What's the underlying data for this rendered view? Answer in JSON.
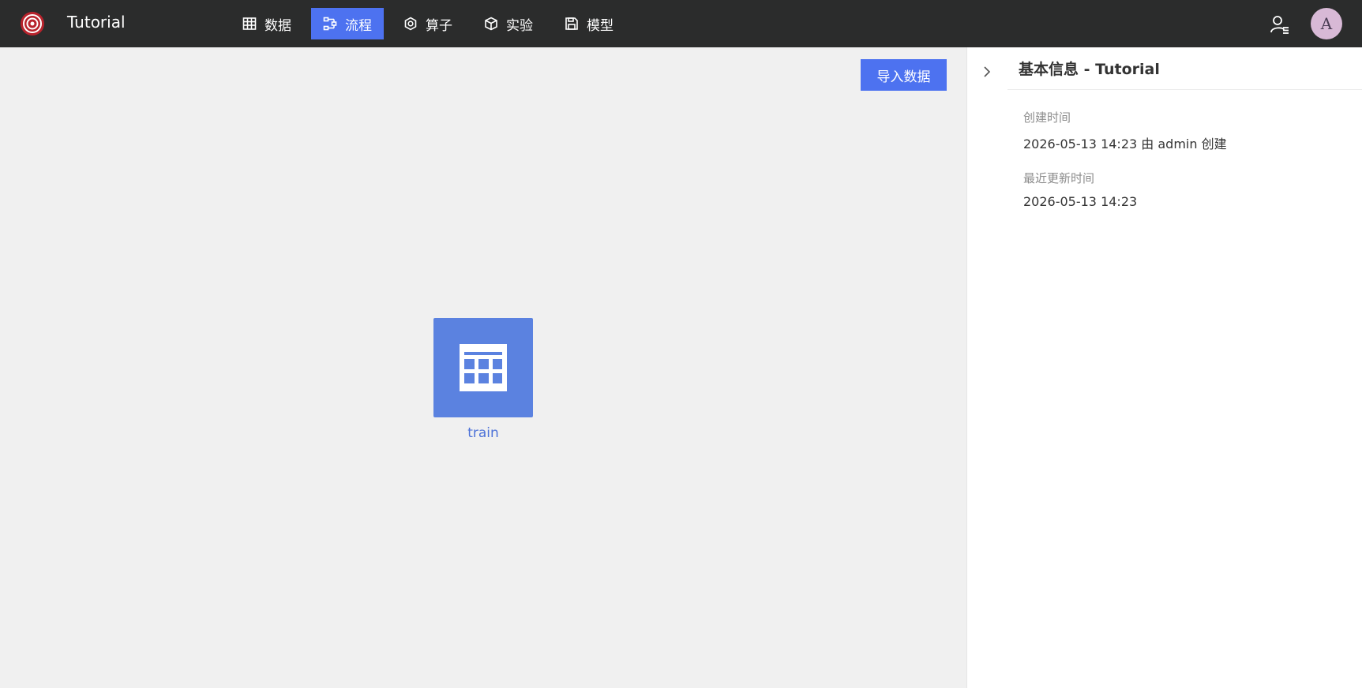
{
  "app": {
    "title": "Tutorial"
  },
  "nav": [
    {
      "label": "数据",
      "icon": "table-icon",
      "active": false
    },
    {
      "label": "流程",
      "icon": "flow-icon",
      "active": true
    },
    {
      "label": "算子",
      "icon": "hexagon-icon",
      "active": false
    },
    {
      "label": "实验",
      "icon": "cube-icon",
      "active": false
    },
    {
      "label": "模型",
      "icon": "save-icon",
      "active": false
    }
  ],
  "user": {
    "avatar_letter": "A"
  },
  "canvas": {
    "import_button": "导入数据",
    "node": {
      "label": "train",
      "icon": "table-grid-icon"
    }
  },
  "panel": {
    "title": "基本信息 - Tutorial",
    "created_label": "创建时间",
    "created_value": "2026-05-13 14:23  由 admin 创建",
    "updated_label": "最近更新时间",
    "updated_value": "2026-05-13 14:23"
  },
  "colors": {
    "accent": "#4d72f0",
    "topbar": "#2b2c2c",
    "node": "#5b82e0"
  }
}
